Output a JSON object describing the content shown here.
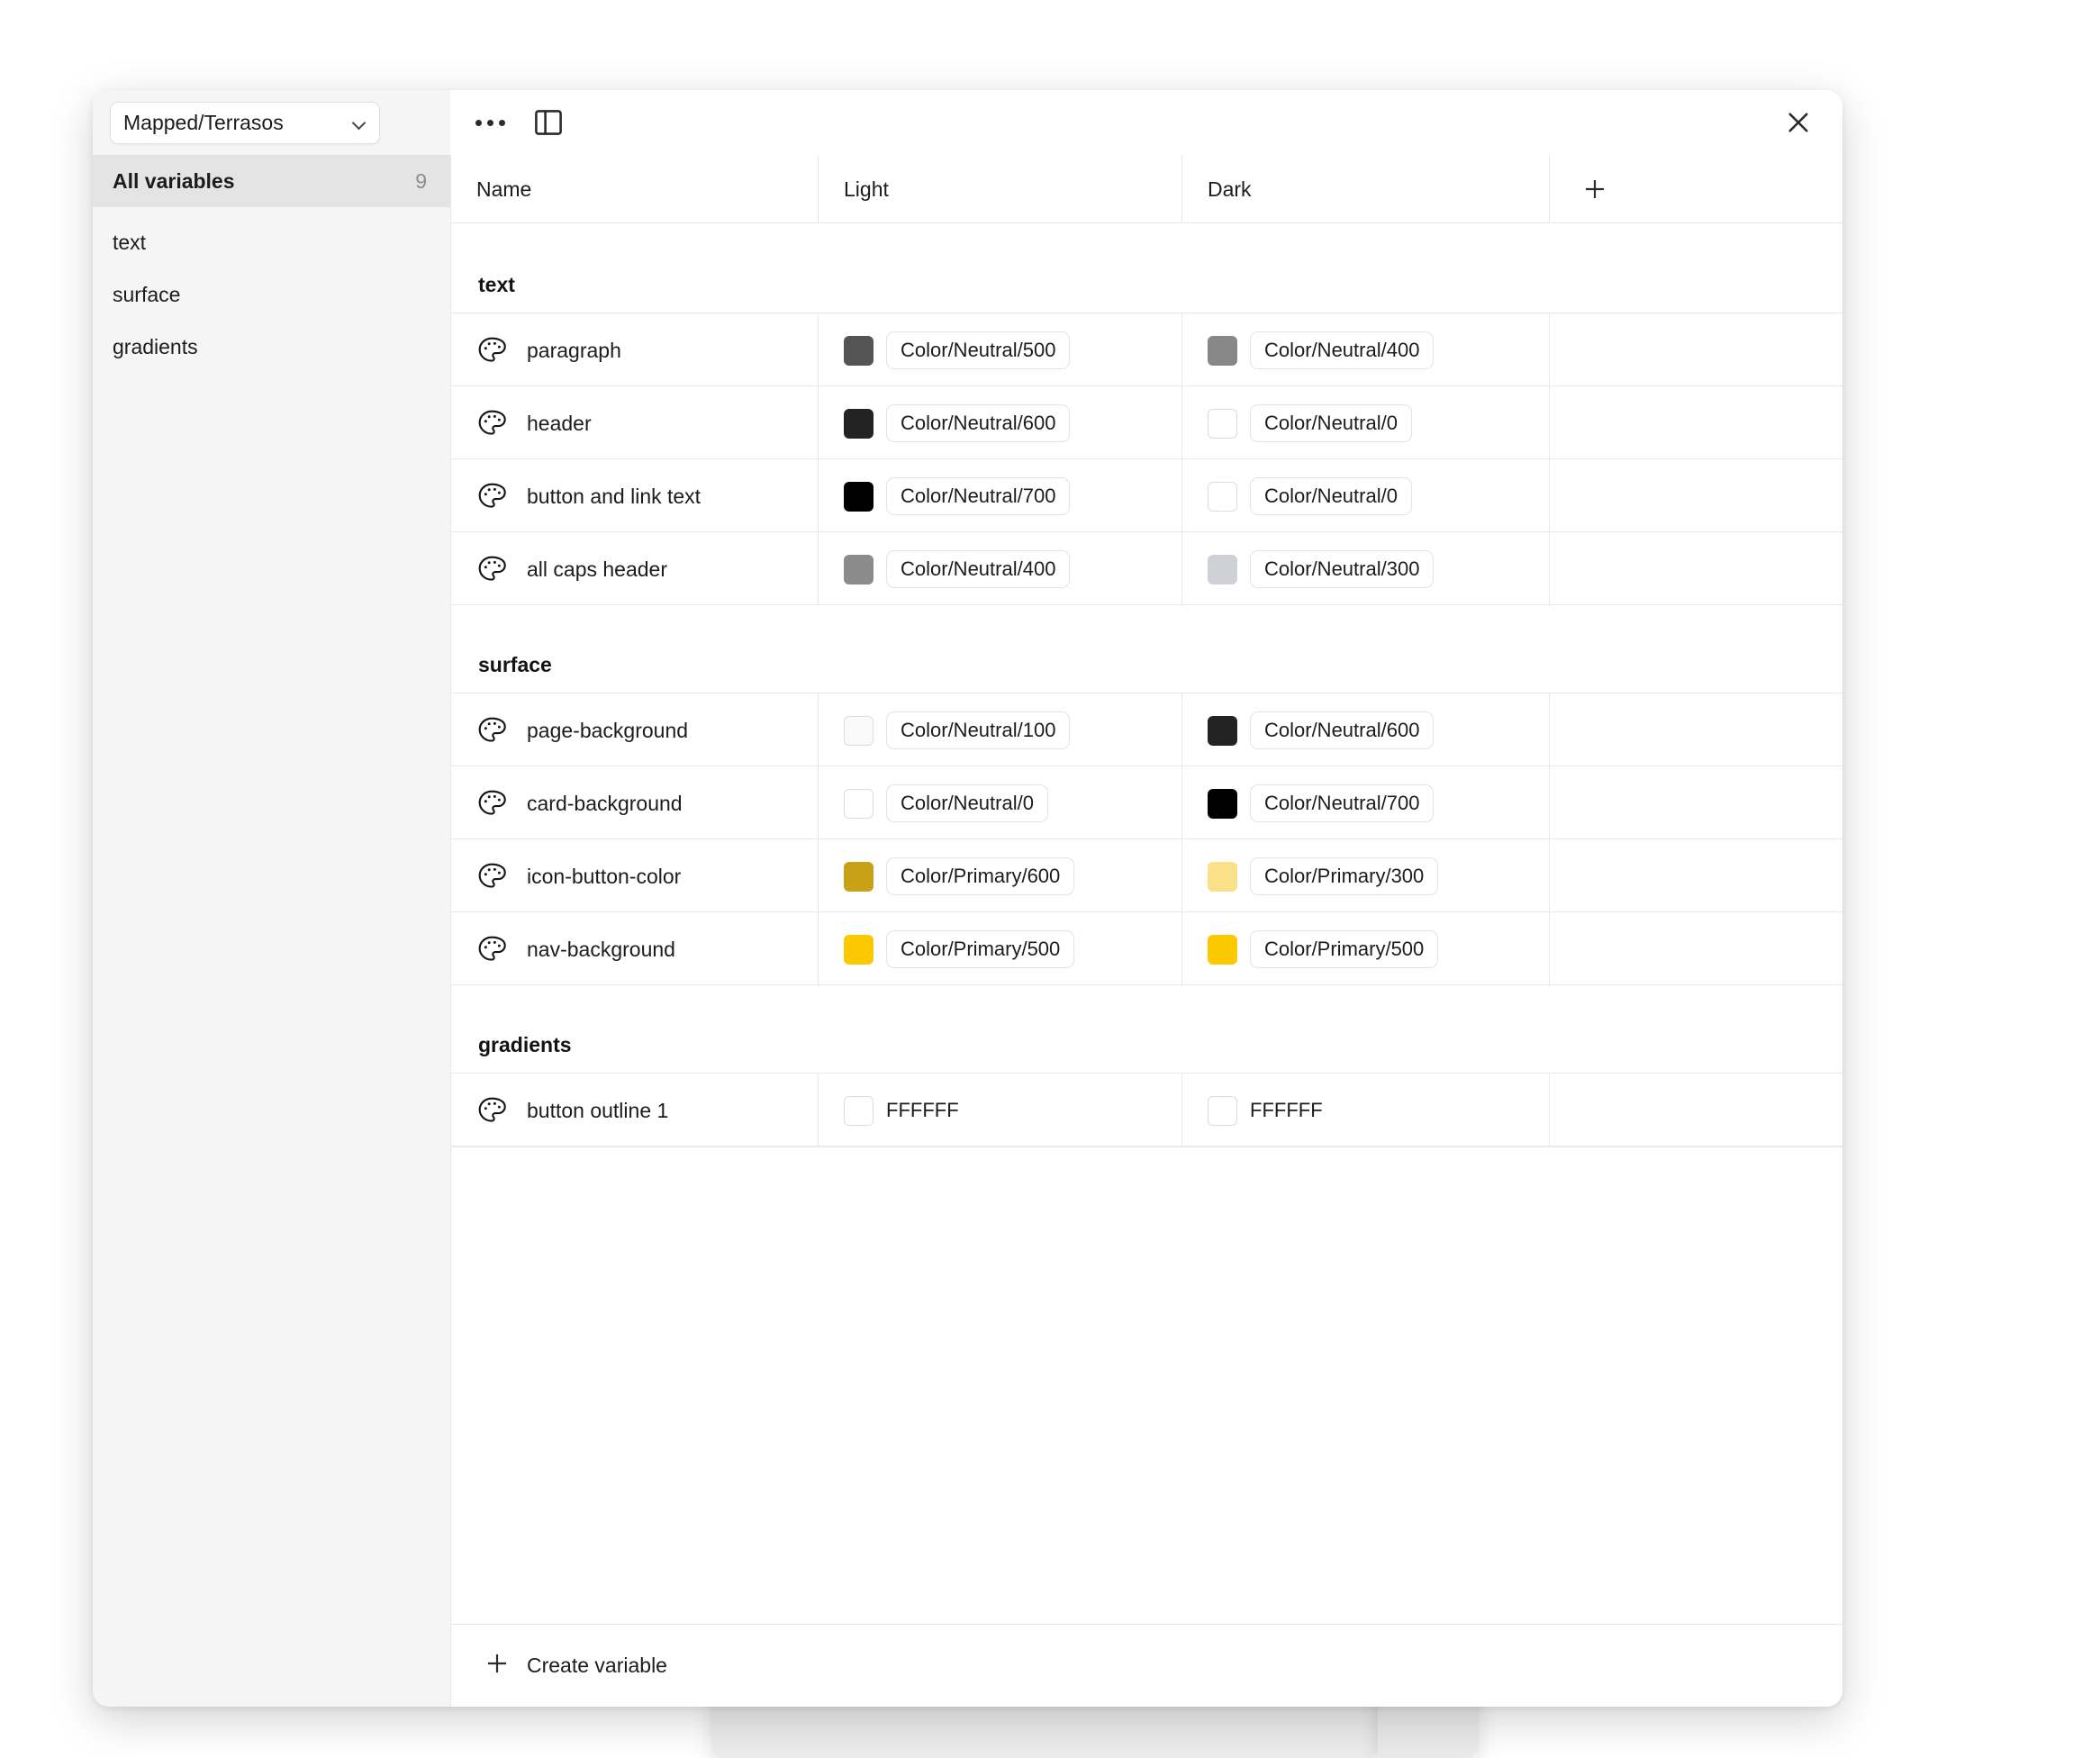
{
  "window": {
    "collection_selector": {
      "value": "Mapped/Terrasos",
      "chevron_icon": "chevron-down-icon"
    },
    "more_menu_icon": "more-horizontal-icon",
    "panel_toggle_icon": "sidebar-panel-icon",
    "close_icon": "close-icon"
  },
  "sidebar": {
    "items": [
      {
        "label": "All variables",
        "count": "9",
        "active": true
      },
      {
        "label": "text",
        "count": "",
        "active": false
      },
      {
        "label": "surface",
        "count": "",
        "active": false
      },
      {
        "label": "gradients",
        "count": "",
        "active": false
      }
    ]
  },
  "table": {
    "columns": {
      "name": "Name",
      "light": "Light",
      "dark": "Dark",
      "add_mode_icon": "plus-icon"
    },
    "groups": [
      {
        "name": "text",
        "rows": [
          {
            "icon": "color-palette-icon",
            "name": "paragraph",
            "light": {
              "value": "Color/Neutral/500",
              "swatch": "#545454",
              "style": "pill"
            },
            "dark": {
              "value": "Color/Neutral/400",
              "swatch": "#878787",
              "style": "pill"
            }
          },
          {
            "icon": "color-palette-icon",
            "name": "header",
            "light": {
              "value": "Color/Neutral/600",
              "swatch": "#232323",
              "style": "pill"
            },
            "dark": {
              "value": "Color/Neutral/0",
              "swatch": "#ffffff",
              "style": "pill"
            }
          },
          {
            "icon": "color-palette-icon",
            "name": "button and link text",
            "light": {
              "value": "Color/Neutral/700",
              "swatch": "#000000",
              "style": "pill"
            },
            "dark": {
              "value": "Color/Neutral/0",
              "swatch": "#ffffff",
              "style": "pill"
            }
          },
          {
            "icon": "color-palette-icon",
            "name": "all caps header",
            "light": {
              "value": "Color/Neutral/400",
              "swatch": "#8b8b8b",
              "style": "pill"
            },
            "dark": {
              "value": "Color/Neutral/300",
              "swatch": "#cfd1d4",
              "style": "pill"
            }
          }
        ]
      },
      {
        "name": "surface",
        "rows": [
          {
            "icon": "color-palette-icon",
            "name": "page-background",
            "light": {
              "value": "Color/Neutral/100",
              "swatch": "#fafafa",
              "style": "pill"
            },
            "dark": {
              "value": "Color/Neutral/600",
              "swatch": "#232323",
              "style": "pill"
            }
          },
          {
            "icon": "color-palette-icon",
            "name": "card-background",
            "light": {
              "value": "Color/Neutral/0",
              "swatch": "#ffffff",
              "style": "pill"
            },
            "dark": {
              "value": "Color/Neutral/700",
              "swatch": "#000000",
              "style": "pill"
            }
          },
          {
            "icon": "color-palette-icon",
            "name": "icon-button-color",
            "light": {
              "value": "Color/Primary/600",
              "swatch": "#c9a117",
              "style": "pill"
            },
            "dark": {
              "value": "Color/Primary/300",
              "swatch": "#fbe08a",
              "style": "pill"
            }
          },
          {
            "icon": "color-palette-icon",
            "name": "nav-background",
            "light": {
              "value": "Color/Primary/500",
              "swatch": "#fcc900",
              "style": "pill"
            },
            "dark": {
              "value": "Color/Primary/500",
              "swatch": "#fcc900",
              "style": "pill"
            }
          }
        ]
      },
      {
        "name": "gradients",
        "rows": [
          {
            "icon": "color-palette-icon",
            "name": "button outline 1",
            "light": {
              "value": "FFFFFF",
              "swatch": "#ffffff",
              "style": "plain"
            },
            "dark": {
              "value": "FFFFFF",
              "swatch": "#ffffff",
              "style": "plain"
            }
          }
        ]
      }
    ]
  },
  "footer": {
    "create_label": "Create variable",
    "create_icon": "plus-icon"
  }
}
